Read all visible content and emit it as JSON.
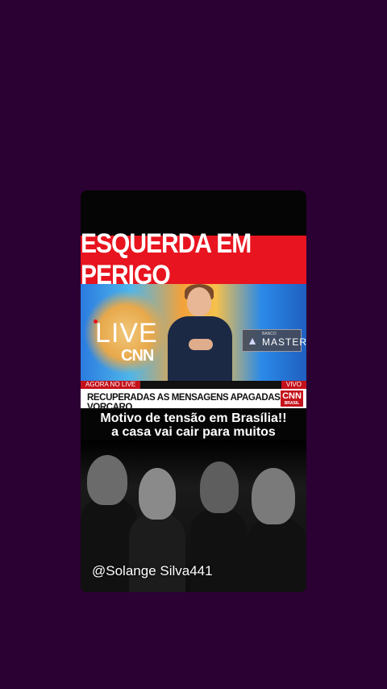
{
  "headline": "ESQUERDA EM PERIGO",
  "studio": {
    "live_label": "LIVE",
    "cnn_label": "CNN",
    "sponsor_small": "BANCO",
    "sponsor_big": "MASTER"
  },
  "ticker": {
    "agora_label": "AGORA NO LIVE",
    "vivo_label": "VIVO",
    "lower_third": "RECUPERADAS AS MENSAGENS APAGADAS DE VORCARO",
    "logo_text": "CNN",
    "logo_sub": "BRASIL"
  },
  "caption": {
    "line1": "Motivo de tensão em Brasília!!",
    "line2": "a casa vai cair para muitos"
  },
  "handle": "@Solange Silva441",
  "colors": {
    "background": "#2b0033",
    "headline_red": "#e8141f",
    "cnn_red": "#c4111a"
  }
}
